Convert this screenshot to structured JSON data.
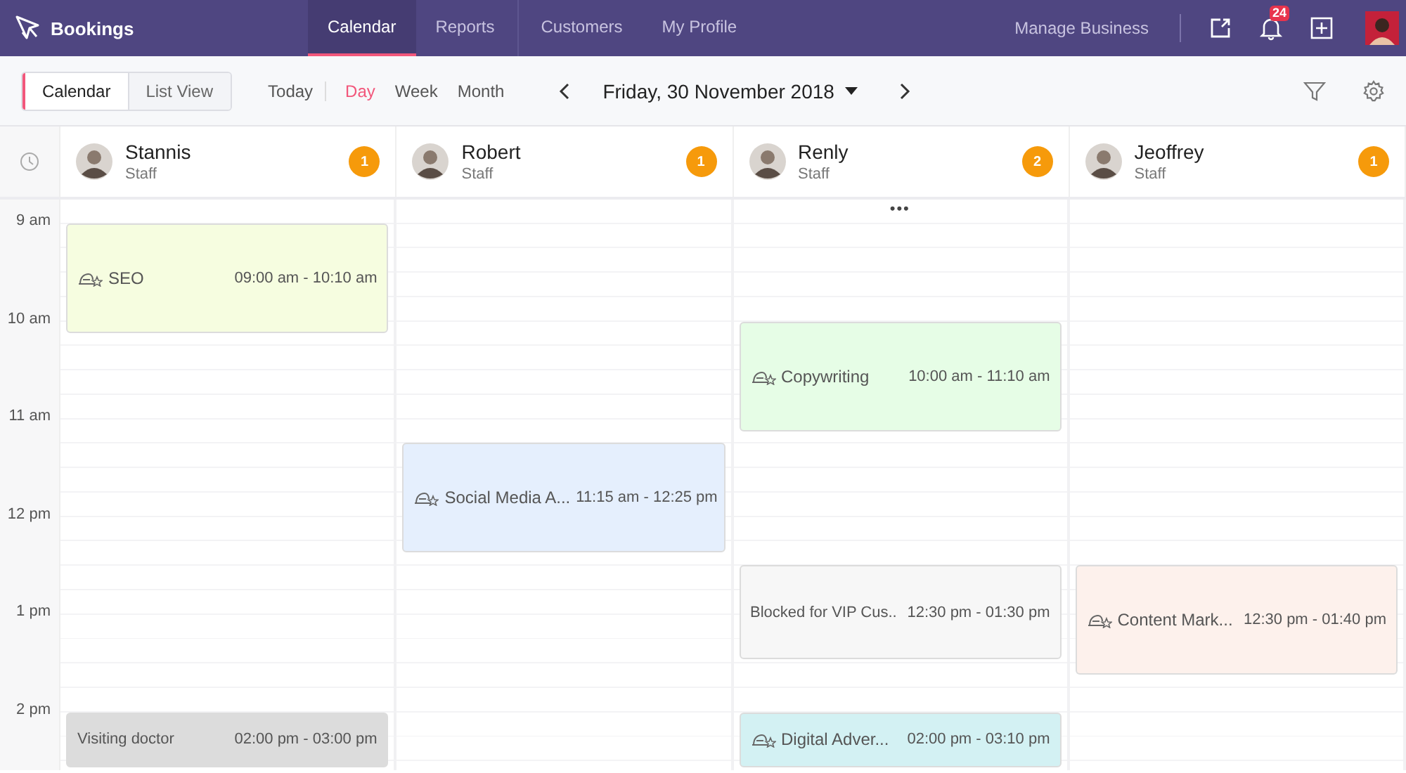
{
  "app": {
    "title": "Bookings"
  },
  "nav_tabs": [
    {
      "label": "Calendar",
      "selected": true
    },
    {
      "label": "Reports",
      "selected": false
    },
    {
      "label": "Customers",
      "selected": false
    },
    {
      "label": "My Profile",
      "selected": false
    }
  ],
  "top_actions": {
    "manage_link": "Manage Business",
    "notification_count": "24"
  },
  "view_toggle": [
    {
      "label": "Calendar",
      "selected": true
    },
    {
      "label": "List View",
      "selected": false
    }
  ],
  "today_button": "Today",
  "range_tabs": [
    {
      "label": "Day",
      "selected": true
    },
    {
      "label": "Week",
      "selected": false
    },
    {
      "label": "Month",
      "selected": false
    }
  ],
  "date_picker": {
    "label": "Friday, 30 November 2018"
  },
  "time_labels": [
    "9 am",
    "10 am",
    "11 am",
    "12 pm",
    "1 pm",
    "2 pm"
  ],
  "staff": [
    {
      "name": "Stannis",
      "role": "Staff",
      "count": "1",
      "events": [
        {
          "kind": "service",
          "title": "SEO",
          "time": "09:00 am - 10:10 am",
          "color": "#f6fde0"
        },
        {
          "kind": "blocked",
          "title": "Visiting doctor",
          "time": "02:00 pm - 03:00 pm",
          "color": "#dcdcdc"
        }
      ]
    },
    {
      "name": "Robert",
      "role": "Staff",
      "count": "1",
      "events": [
        {
          "kind": "service",
          "title": "Social Media A...",
          "time": "11:15 am - 12:25 pm",
          "color": "#e5effd"
        }
      ]
    },
    {
      "name": "Renly",
      "role": "Staff",
      "count": "2",
      "more": "•••",
      "events": [
        {
          "kind": "service",
          "title": "Copywriting",
          "time": "10:00 am - 11:10 am",
          "color": "#e6fde6"
        },
        {
          "kind": "blocked",
          "title": "Blocked for VIP Cus..",
          "time": "12:30 pm - 01:30 pm",
          "color": "#f7f7f7"
        },
        {
          "kind": "service",
          "title": "Digital Adver...",
          "time": "02:00 pm - 03:10 pm",
          "color": "#d3f1f3"
        }
      ]
    },
    {
      "name": "Jeoffrey",
      "role": "Staff",
      "count": "1",
      "events": [
        {
          "kind": "service",
          "title": "Content Mark...",
          "time": "12:30 pm - 01:40 pm",
          "color": "#fdf1ec"
        }
      ]
    }
  ]
}
